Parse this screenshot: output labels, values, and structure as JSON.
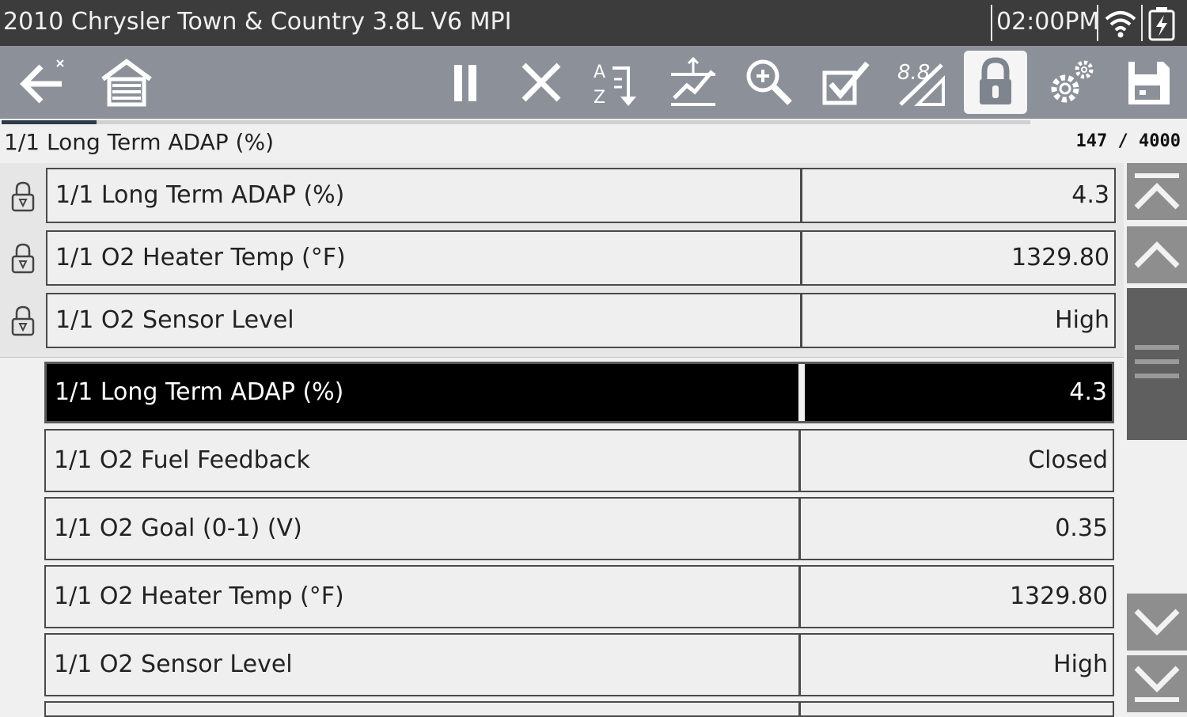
{
  "title_bar": {
    "title": "2010 Chrysler Town & Country 3.8L V6 MPI",
    "time": "02:00PM",
    "wifi_icon": "wifi-icon",
    "battery_icon": "battery-charging-icon"
  },
  "toolbar": {
    "icons": [
      "back-icon",
      "home-icon",
      "pause-icon",
      "clear-icon",
      "sort-icon",
      "graph-icon",
      "zoom-icon",
      "select-icon",
      "units-icon",
      "lock-icon",
      "settings-icon",
      "save-icon"
    ],
    "active": "lock-icon"
  },
  "progress": {
    "fraction": 0.0925
  },
  "header": {
    "selected_name": "1/1 Long Term ADAP (%)",
    "counter": "147 / 4000"
  },
  "locked_rows": [
    {
      "name": "1/1 Long Term ADAP (%)",
      "value": "4.3"
    },
    {
      "name": "1/1 O2 Heater Temp (°F)",
      "value": "1329.80"
    },
    {
      "name": "1/1 O2 Sensor Level",
      "value": "High"
    }
  ],
  "rows": [
    {
      "name": "1/1 Long Term ADAP (%)",
      "value": "4.3",
      "selected": true
    },
    {
      "name": "1/1 O2 Fuel Feedback",
      "value": "Closed"
    },
    {
      "name": "1/1 O2 Goal (0-1) (V)",
      "value": "0.35"
    },
    {
      "name": "1/1 O2 Heater Temp (°F)",
      "value": "1329.80"
    },
    {
      "name": "1/1 O2 Sensor Level",
      "value": "High"
    }
  ],
  "colors": {
    "title_bar_bg": "#3c3c3c",
    "toolbar_bg": "#8c9199",
    "selected_row_bg": "#000000",
    "scroll_button_bg": "#8e8e8e"
  }
}
